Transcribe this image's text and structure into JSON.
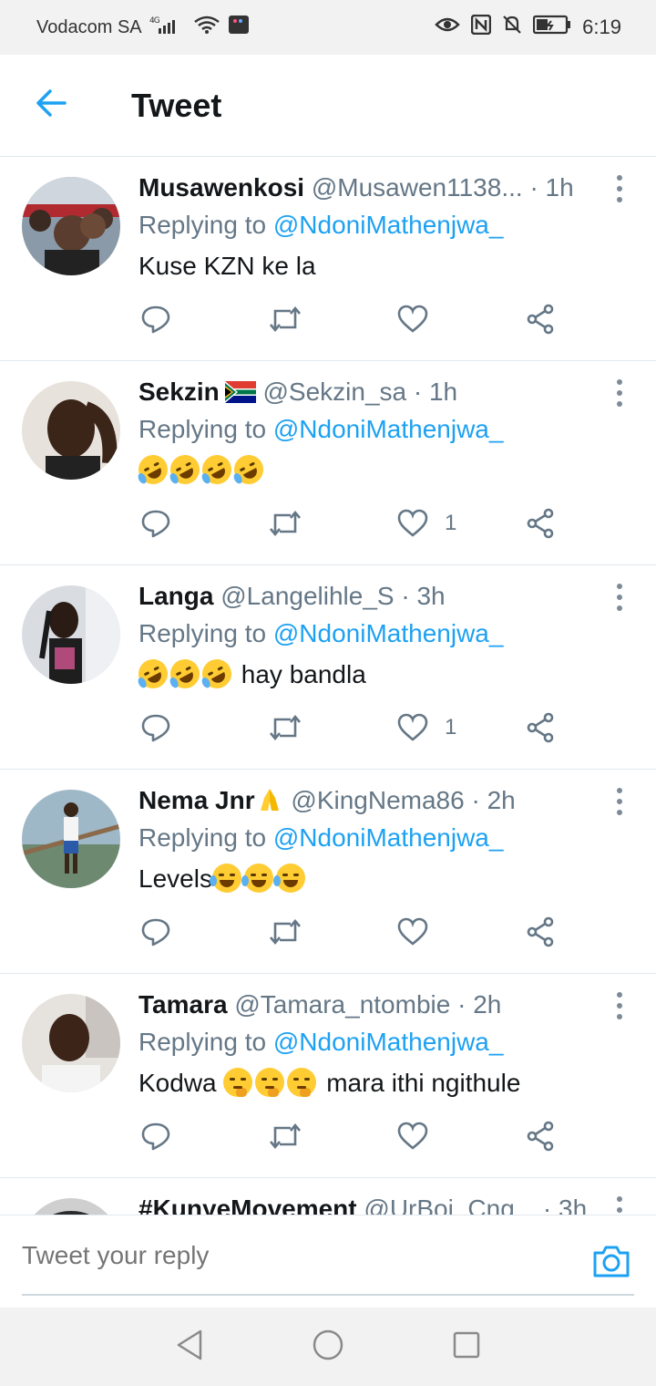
{
  "status_bar": {
    "carrier": "Vodacom SA",
    "network": "4G",
    "time": "6:19"
  },
  "header": {
    "title": "Tweet"
  },
  "tweets": [
    {
      "name": "Musawenkosi",
      "handle": "@Musawen1138...",
      "time": "· 1h",
      "replying_label": "Replying to",
      "replying_to": "@NdoniMathenjwa_",
      "text": "Kuse KZN ke la",
      "likes": ""
    },
    {
      "name": "Sekzin",
      "handle": "@Sekzin_sa",
      "time": "· 1h",
      "replying_label": "Replying to",
      "replying_to": "@NdoniMathenjwa_",
      "text": "",
      "likes": "1"
    },
    {
      "name": "Langa",
      "handle": "@Langelihle_S",
      "time": "· 3h",
      "replying_label": "Replying to",
      "replying_to": "@NdoniMathenjwa_",
      "text": "hay bandla",
      "likes": "1"
    },
    {
      "name": "Nema Jnr",
      "handle": "@KingNema86",
      "time": "· 2h",
      "replying_label": "Replying to",
      "replying_to": "@NdoniMathenjwa_",
      "text": "Levels",
      "likes": ""
    },
    {
      "name": "Tamara",
      "handle": "@Tamara_ntombie",
      "time": "· 2h",
      "replying_label": "Replying to",
      "replying_to": "@NdoniMathenjwa_",
      "text_before": "Kodwa",
      "text_after": "mara ithi ngithule",
      "likes": ""
    },
    {
      "name": "#KunyeMovement",
      "handle": "@UrBoi_Cng...",
      "time": "· 3h"
    }
  ],
  "composer": {
    "placeholder": "Tweet your reply"
  },
  "icons": {
    "back": "arrow-left-icon",
    "reply": "reply-icon",
    "retweet": "retweet-icon",
    "like": "heart-icon",
    "share": "share-icon",
    "more": "more-vertical-icon",
    "camera": "camera-icon"
  },
  "colors": {
    "accent": "#1da1f2",
    "secondary_text": "#657786",
    "divider": "#e1e8ed"
  }
}
